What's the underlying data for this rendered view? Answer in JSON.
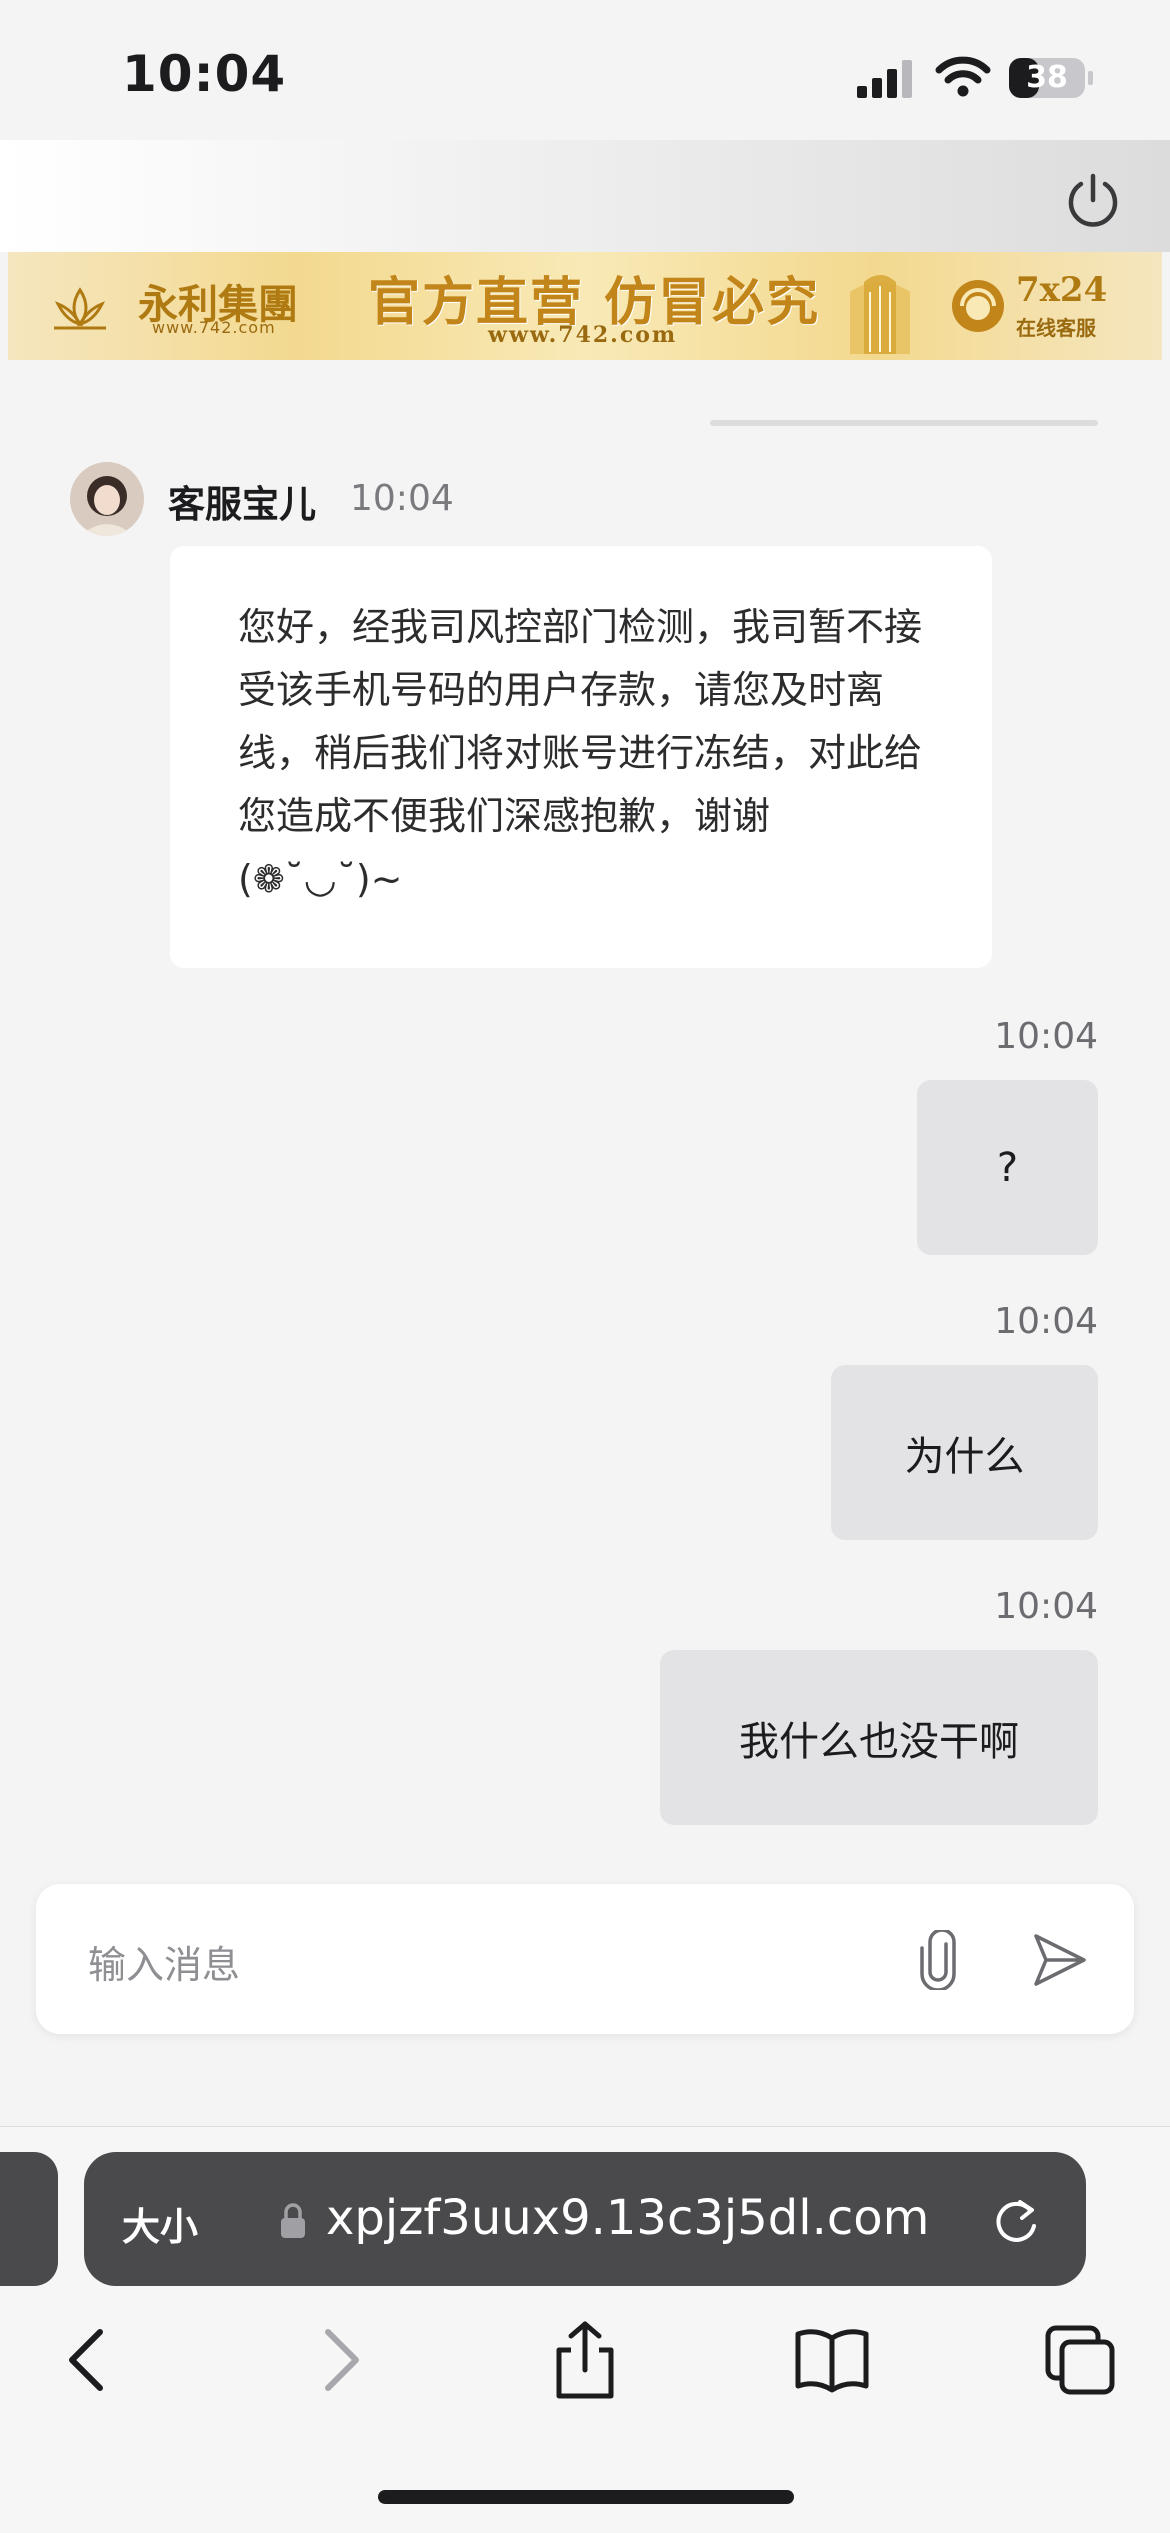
{
  "status_bar": {
    "time": "10:04",
    "battery": "38"
  },
  "banner": {
    "brand": "永利集團",
    "site": "www.742.com",
    "slogan": "官方直营  仿冒必究",
    "url": "www.742.com",
    "support_number": "7x24",
    "support_text": "在线客服"
  },
  "agent": {
    "name": "客服宝儿",
    "time": "10:04",
    "message": "您好，经我司风控部门检测，我司暂不接受该手机号码的用户存款，请您及时离线，稍后我们将对账号进行冻结，对此给您造成不便我们深感抱歉，谢谢 (❁˘◡˘)~"
  },
  "user_messages": [
    {
      "time": "10:04",
      "text": "?"
    },
    {
      "time": "10:04",
      "text": "为什么"
    },
    {
      "time": "10:04",
      "text": "我什么也没干啊"
    }
  ],
  "composer": {
    "placeholder": "输入消息"
  },
  "safari": {
    "text_size_label": "大小",
    "url": "xpjzf3uux9.13c3j5dl.com"
  },
  "icons": {
    "power": "power-icon",
    "attach": "paperclip-icon",
    "send": "send-icon",
    "back": "chevron-left-icon",
    "forward": "chevron-right-icon",
    "share": "share-icon",
    "bookmarks": "book-icon",
    "tabs": "tabs-icon"
  },
  "colors": {
    "banner_gold": "#c2851a",
    "bubble_user": "#e3e3e5",
    "url_pill": "#4a4a4c"
  }
}
